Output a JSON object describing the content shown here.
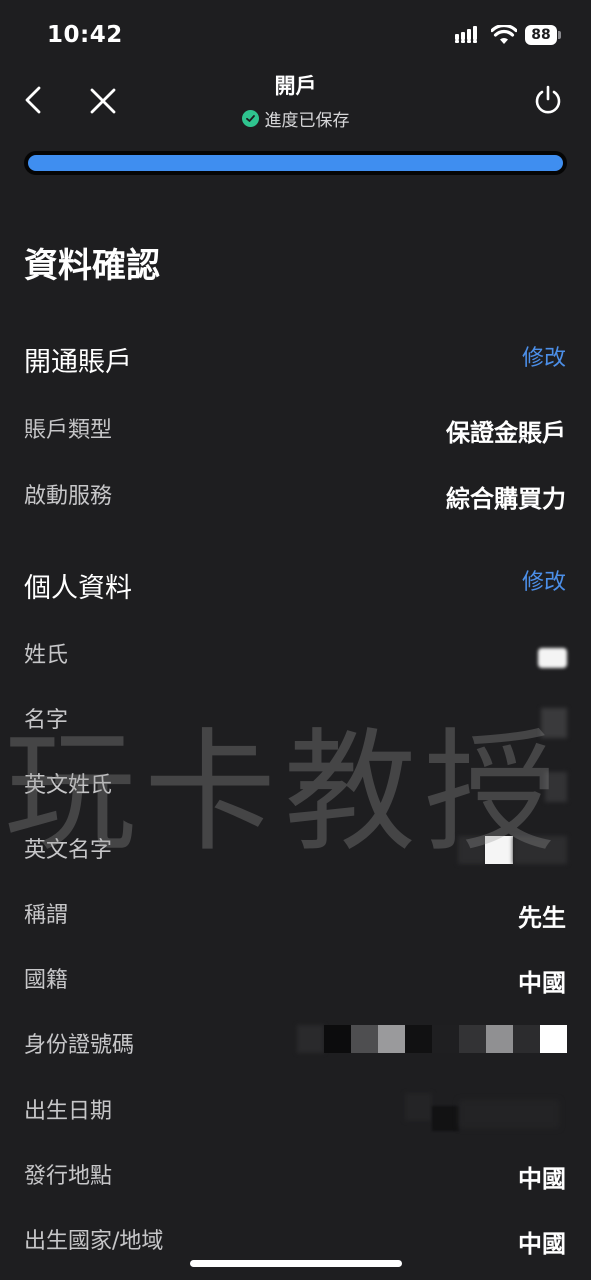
{
  "status_bar": {
    "time": "10:42",
    "battery": "88"
  },
  "nav": {
    "title": "開戶",
    "subtitle": "進度已保存",
    "progress": 1.0
  },
  "page": {
    "title": "資料確認"
  },
  "sections": {
    "account": {
      "title": "開通賬戶",
      "edit_label": "修改",
      "rows": [
        {
          "label": "賬戶類型",
          "value": "保證金賬戶"
        },
        {
          "label": "啟動服務",
          "value": "綜合購買力"
        }
      ]
    },
    "personal": {
      "title": "個人資料",
      "edit_label": "修改",
      "rows": [
        {
          "label": "姓氏",
          "value": ""
        },
        {
          "label": "名字",
          "value": ""
        },
        {
          "label": "英文姓氏",
          "value": ""
        },
        {
          "label": "英文名字",
          "value": ""
        },
        {
          "label": "稱謂",
          "value": "先生"
        },
        {
          "label": "國籍",
          "value": "中國"
        },
        {
          "label": "身份證號碼",
          "value": ""
        },
        {
          "label": "出生日期",
          "value": ""
        },
        {
          "label": "發行地點",
          "value": "中國"
        },
        {
          "label": "出生國家/地域",
          "value": "中國"
        }
      ]
    }
  },
  "watermark": "玩卡教授",
  "colors": {
    "background": "#1e1e20",
    "accent": "#4c8fe8",
    "progress": "#3f8ef0",
    "saved_check": "#2fc48f"
  }
}
